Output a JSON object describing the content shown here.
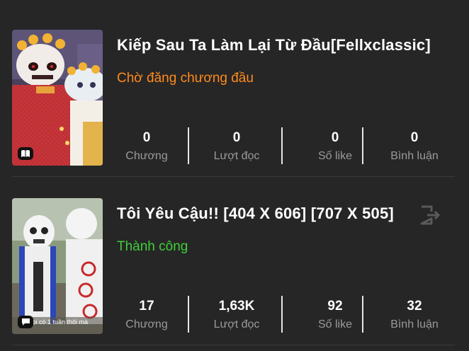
{
  "stories": [
    {
      "title": "Kiếp Sau Ta Làm Lại Từ Đầu[Fellxclassic]",
      "status": "Chờ đăng chương đầu",
      "status_color": "#ff8a1c",
      "badge_icon": "book-icon",
      "stats": [
        {
          "value": "0",
          "label": "Chương"
        },
        {
          "value": "0",
          "label": "Lượt đọc"
        },
        {
          "value": "0",
          "label": "Số like"
        },
        {
          "value": "0",
          "label": "Bình luận"
        }
      ]
    },
    {
      "title": "Tôi Yêu Cậu!! [404 X 606] [707 X 505]",
      "status": "Thành công",
      "status_color": "#3fcf3a",
      "badge_icon": "chat-icon",
      "action_icon": "exit-icon",
      "cover_caption": "Mọi có 1 tuần thôi mà",
      "stats": [
        {
          "value": "17",
          "label": "Chương"
        },
        {
          "value": "1,63K",
          "label": "Lượt đọc"
        },
        {
          "value": "92",
          "label": "Số like"
        },
        {
          "value": "32",
          "label": "Bình luận"
        }
      ]
    }
  ]
}
